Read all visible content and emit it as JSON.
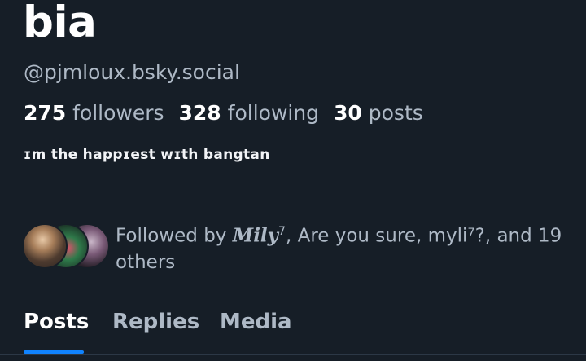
{
  "profile": {
    "display_name": "bia",
    "handle": "@pjmloux.bsky.social",
    "bio": "ɪm the happɪest wɪth bangtan"
  },
  "stats": {
    "followers_count": "275",
    "followers_label": "followers",
    "following_count": "328",
    "following_label": "following",
    "posts_count": "30",
    "posts_label": "posts"
  },
  "followed_by": {
    "prefix": "Followed by ",
    "first": "Mily",
    "first_sup": "7",
    "rest": ", Are you sure, myli⁷?, and 19 others"
  },
  "tabs": [
    {
      "label": "Posts",
      "active": true
    },
    {
      "label": "Replies",
      "active": false
    },
    {
      "label": "Media",
      "active": false
    }
  ],
  "colors": {
    "background": "#161e27",
    "muted_text": "#aeb9c6",
    "accent": "#1083fe"
  }
}
